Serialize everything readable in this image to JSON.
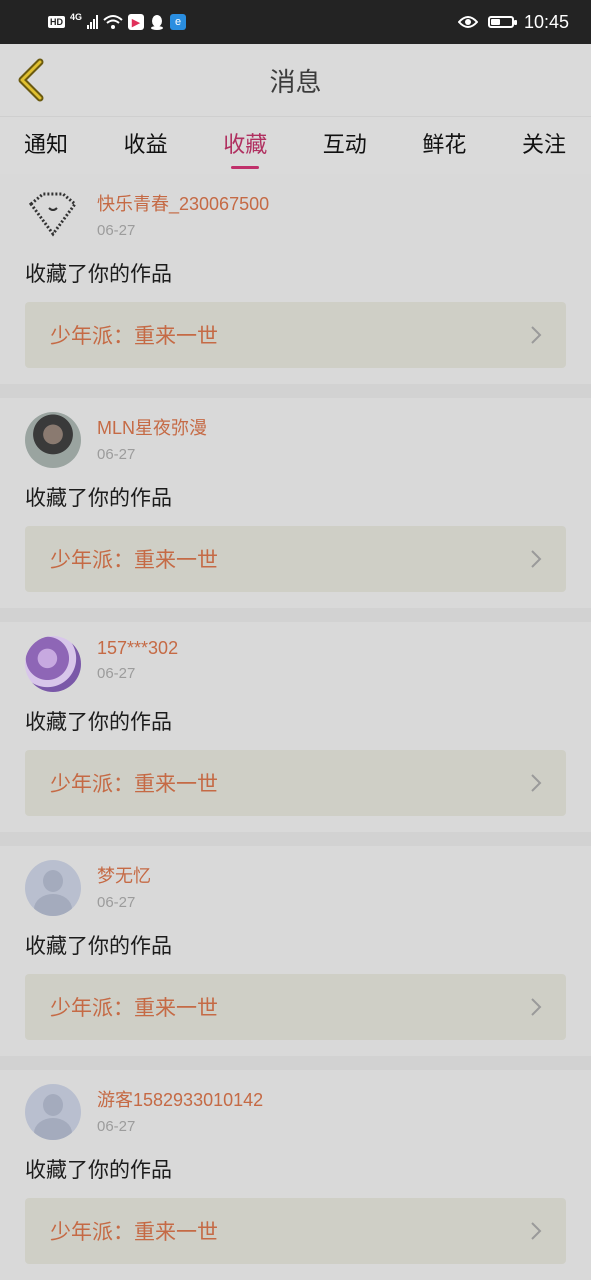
{
  "status_bar": {
    "hd": "HD",
    "network": "4G",
    "time": "10:45",
    "battery_level": 0.45
  },
  "header": {
    "title": "消息",
    "back_icon": "chevron-left-icon"
  },
  "tabs": [
    {
      "label": "通知",
      "active": false
    },
    {
      "label": "收益",
      "active": false
    },
    {
      "label": "收藏",
      "active": true
    },
    {
      "label": "互动",
      "active": false
    },
    {
      "label": "鲜花",
      "active": false
    },
    {
      "label": "关注",
      "active": false
    }
  ],
  "items": [
    {
      "name": "快乐青春_230067500",
      "date": "06-27",
      "action": "收藏了你的作品",
      "work": "少年派：重来一世",
      "avatar": "diamond"
    },
    {
      "name": "MLN星夜弥漫",
      "date": "06-27",
      "action": "收藏了你的作品",
      "work": "少年派：重来一世",
      "avatar": "photo"
    },
    {
      "name": "157***302",
      "date": "06-27",
      "action": "收藏了你的作品",
      "work": "少年派：重来一世",
      "avatar": "purple"
    },
    {
      "name": "梦无忆",
      "date": "06-27",
      "action": "收藏了你的作品",
      "work": "少年派：重来一世",
      "avatar": "default"
    },
    {
      "name": "游客1582933010142",
      "date": "06-27",
      "action": "收藏了你的作品",
      "work": "少年派：重来一世",
      "avatar": "default"
    }
  ],
  "colors": {
    "accent": "#c0306a",
    "username": "#c56a45"
  }
}
